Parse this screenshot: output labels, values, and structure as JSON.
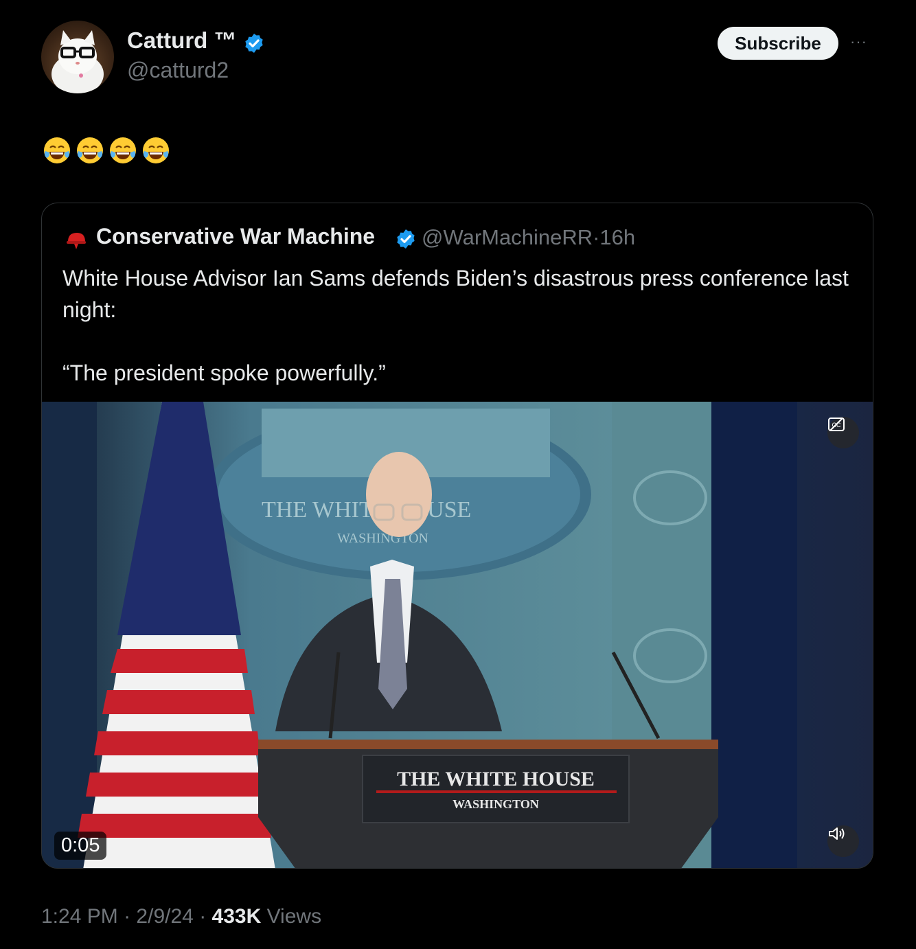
{
  "author": {
    "display_name": "Catturd ™",
    "handle": "@catturd2",
    "avatar": "cat-with-glasses-avatar",
    "verified": true
  },
  "actions": {
    "subscribe_label": "Subscribe",
    "more_label": "···"
  },
  "post": {
    "emoji_text": "😂😂😂😂"
  },
  "quoted": {
    "icon": "red-helmet-icon",
    "display_name": "Conservative War Machine",
    "handle": "@WarMachineRR",
    "separator": "·",
    "age": "16h",
    "text_line1": "White House Advisor Ian Sams defends Biden’s disastrous press conference last night:",
    "text_line2": "“The president spoke powerfully.”",
    "video": {
      "duration": "0:05",
      "podium_title": "THE WHITE HOUSE",
      "podium_subtitle": "WASHINGTON",
      "backdrop_title": "THE WHITE HOUSE",
      "backdrop_subtitle": "WASHINGTON"
    }
  },
  "footer": {
    "time": "1:24 PM",
    "sep1": "·",
    "date": "2/9/24",
    "sep2": "·",
    "views_count": "433K",
    "views_label": "Views"
  },
  "colors": {
    "background": "#000000",
    "verified_blue": "#1d9bf0",
    "muted": "#71767b",
    "text": "#e7e9ea"
  }
}
